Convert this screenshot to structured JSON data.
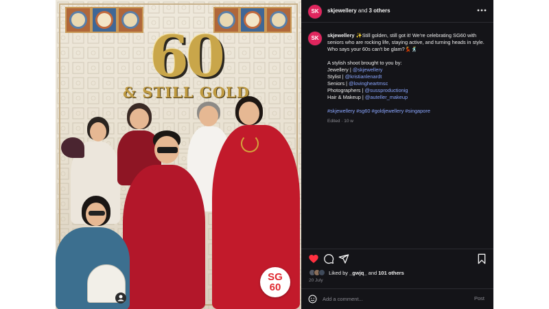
{
  "image": {
    "number": "60",
    "slogan": "& STILL GOLD",
    "badge_top": "SG",
    "badge_bottom": "60",
    "colors": {
      "gold": "#c9a64a",
      "red": "#b2142a",
      "tile": "#b0673a",
      "tile_alt": "#3f6796"
    },
    "tag_icon": "person-tag-icon"
  },
  "header": {
    "avatar_text": "SK",
    "username": "skjewellery",
    "connector": " and ",
    "others": "3 others",
    "more_icon": "more-horizontal-icon"
  },
  "caption": {
    "avatar_text": "SK",
    "username": "skjewellery",
    "intro": "✨Still golden, still got it! We're celebrating SG60 with seniors who are rocking life, staying active, and turning heads in style. Who says your 60s can't be glam?💃🕺",
    "shoot_line": "A stylish shoot brought to you by:",
    "credits": [
      {
        "role": "Jewellery | ",
        "handle": "@skjewellery"
      },
      {
        "role": "Stylist | ",
        "handle": "@kristianlenardt"
      },
      {
        "role": "Seniors | ",
        "handle": "@lovingheartmsc"
      },
      {
        "role": "Photographers | ",
        "handle": "@sussproductionig"
      },
      {
        "role": "Hair & Makeup | ",
        "handle": "@auteller_makeup"
      }
    ],
    "hashtags": "#skjewellery #sg60 #goldjewellery #singapore",
    "edited": "Edited · 10 w"
  },
  "actions": {
    "like_icon": "heart-icon",
    "comment_icon": "comment-icon",
    "share_icon": "share-icon",
    "save_icon": "bookmark-icon",
    "like_color": "#ff3040"
  },
  "likes": {
    "prefix": "Liked by ",
    "first_user": "_gwjq_",
    "connector": " and ",
    "others": "101 others",
    "date": "20 July"
  },
  "comment": {
    "emoji_icon": "emoji-icon",
    "placeholder": "Add a comment...",
    "post_label": "Post"
  }
}
